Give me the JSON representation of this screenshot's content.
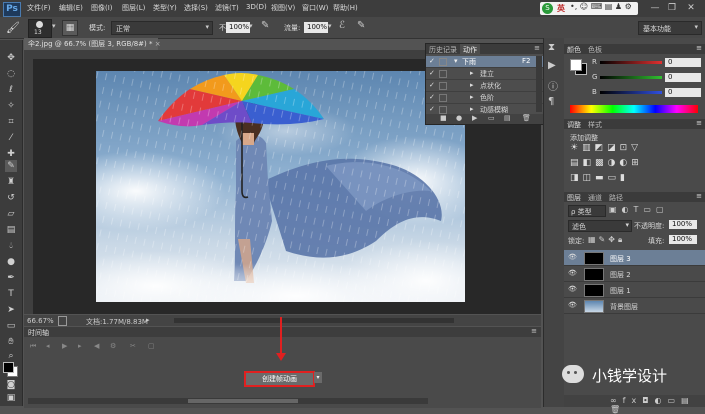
{
  "app": {
    "logo": "Ps",
    "menu": [
      "文件(F)",
      "编辑(E)",
      "图像(I)",
      "图层(L)",
      "类型(Y)",
      "选择(S)",
      "滤镜(T)",
      "3D(D)",
      "视图(V)",
      "窗口(W)",
      "帮助(H)"
    ],
    "ime_label": "英",
    "workspace": "基本功能"
  },
  "options": {
    "brush_size": "13",
    "mode_label": "模式:",
    "mode_value": "正常",
    "opacity_label": "不透明度:",
    "opacity_value": "100%",
    "flow_label": "流量:",
    "flow_value": "100%"
  },
  "document": {
    "tab_title": "伞2.jpg @ 66.7% (图层 3, RGB/8#) *",
    "zoom": "66.67%",
    "doc_size": "文档:1.77M/8.83M"
  },
  "actions_panel": {
    "tabs": [
      "历史记录",
      "动作"
    ],
    "rows": [
      {
        "label": "下雨",
        "shortcut": "F2",
        "selected": true
      },
      {
        "label": "建立",
        "shortcut": "",
        "selected": false
      },
      {
        "label": "点状化",
        "shortcut": "",
        "selected": false
      },
      {
        "label": "色阶",
        "shortcut": "",
        "selected": false
      },
      {
        "label": "动感模糊",
        "shortcut": "",
        "selected": false
      }
    ]
  },
  "timeline": {
    "title": "时间轴",
    "create_button": "创建帧动画"
  },
  "color_panel": {
    "tabs": [
      "颜色",
      "色板"
    ],
    "channels": [
      {
        "label": "R",
        "value": "0",
        "color": "#e03030"
      },
      {
        "label": "G",
        "value": "0",
        "color": "#30c030"
      },
      {
        "label": "B",
        "value": "0",
        "color": "#3050e0"
      }
    ]
  },
  "adjust_panel": {
    "tabs": [
      "调整",
      "样式"
    ],
    "title": "添加调整"
  },
  "layers_panel": {
    "tabs": [
      "图层",
      "通道",
      "路径"
    ],
    "filter_label": "ρ 类型",
    "blend_mode": "滤色",
    "opacity_label": "不透明度:",
    "opacity_value": "100%",
    "lock_label": "锁定:",
    "fill_label": "填充:",
    "fill_value": "100%",
    "layers": [
      {
        "name": "图层 3",
        "selected": true,
        "thumb": "#000000"
      },
      {
        "name": "图层 2",
        "selected": false,
        "thumb": "#000000"
      },
      {
        "name": "图层 1",
        "selected": false,
        "thumb": "#000000"
      },
      {
        "name": "背景图层",
        "selected": false,
        "thumb": "#8aa0b8"
      }
    ]
  },
  "watermark": {
    "text": "小钱学设计"
  },
  "colors": {
    "highlight_red": "#e02020",
    "selected_row": "#6c7f96"
  }
}
